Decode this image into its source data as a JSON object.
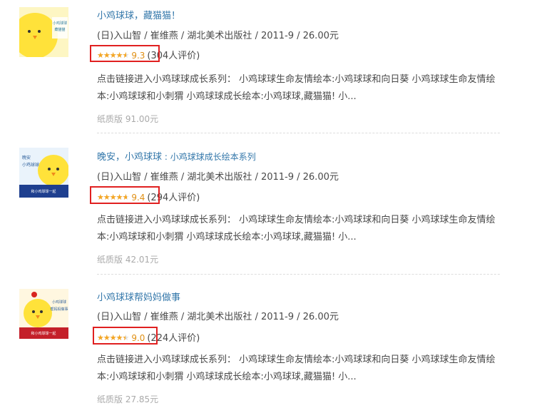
{
  "items": [
    {
      "title": "小鸡球球，藏猫猫！",
      "subtitle": "",
      "meta": "(日)入山智 / 崔维燕 / 湖北美术出版社 / 2011-9 / 26.00元",
      "rating": 9.3,
      "score_text": "9.3",
      "count_text": "(304人评价)",
      "desc": "点击链接进入小鸡球球成长系列： 小鸡球球生命友情绘本:小鸡球球和向日葵 小鸡球球生命友情绘本:小鸡球球和小刺猬 小鸡球球成长绘本:小鸡球球,藏猫猫! 小...",
      "price": "纸质版 91.00元",
      "cover_text": "小鸡球球，藏猫猫！"
    },
    {
      "title": "晚安，小鸡球球",
      "subtitle": " : 小鸡球球成长绘本系列",
      "meta": "(日)入山智 / 崔维燕 / 湖北美术出版社 / 2011-9 / 26.00元",
      "rating": 9.4,
      "score_text": "9.4",
      "count_text": "(294人评价)",
      "desc": "点击链接进入小鸡球球成长系列： 小鸡球球生命友情绘本:小鸡球球和向日葵 小鸡球球生命友情绘本:小鸡球球和小刺猬 小鸡球球成长绘本:小鸡球球,藏猫猫! 小...",
      "price": "纸质版 42.01元",
      "cover_text": "晚安，小鸡球球",
      "cover_banner": "和小鸡球球一起，感受立体阅读"
    },
    {
      "title": "小鸡球球帮妈妈做事",
      "subtitle": "",
      "meta": "(日)入山智 / 崔维燕 / 湖北美术出版社 / 2011-9 / 26.00元",
      "rating": 9.0,
      "score_text": "9.0",
      "count_text": "(224人评价)",
      "desc": "点击链接进入小鸡球球成长系列： 小鸡球球生命友情绘本:小鸡球球和向日葵 小鸡球球生命友情绘本:小鸡球球和小刺猬 小鸡球球成长绘本:小鸡球球,藏猫猫! 小...",
      "price": "纸质版 27.85元",
      "cover_text": "小鸡球球帮妈妈做事",
      "cover_banner": "和小鸡球球一起，感受立体阅读"
    }
  ],
  "star_glyphs": "★★★★★",
  "colors": {
    "link": "#3377aa",
    "star": "#f5a623",
    "highlight": "#e02020"
  }
}
